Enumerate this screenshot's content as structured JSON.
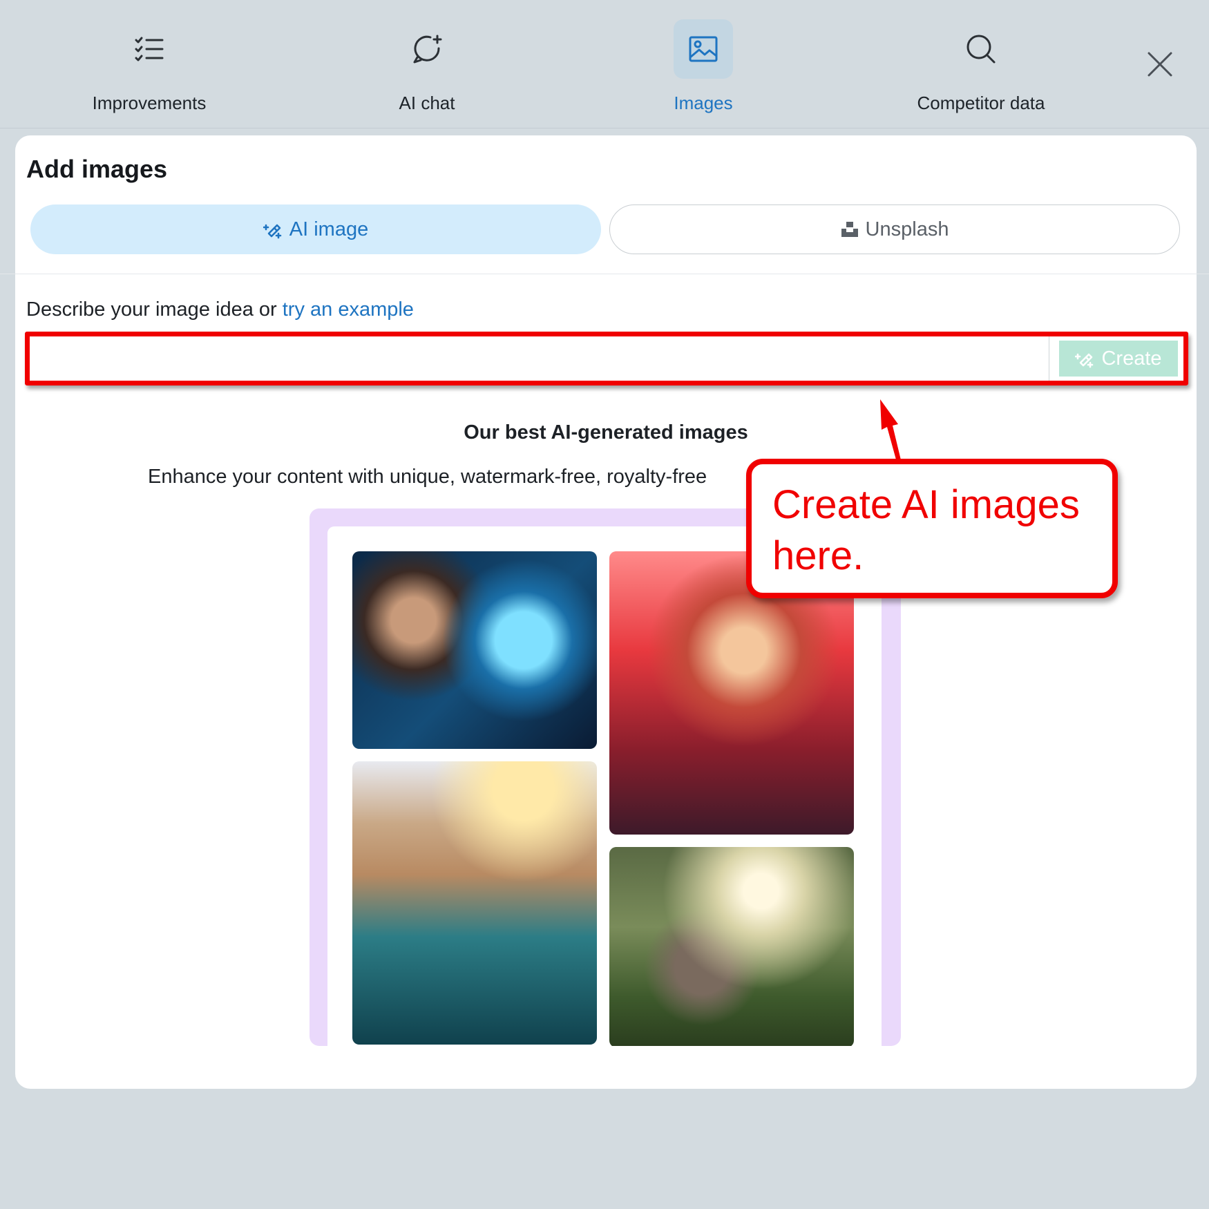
{
  "tabs": [
    {
      "label": "Improvements",
      "icon": "checklist-icon"
    },
    {
      "label": "AI chat",
      "icon": "chat-sparkle-icon"
    },
    {
      "label": "Images",
      "icon": "image-icon"
    },
    {
      "label": "Competitor data",
      "icon": "search-icon"
    }
  ],
  "active_tab": "Images",
  "panel": {
    "title": "Add images",
    "segments": {
      "ai_label": "AI image",
      "unsplash_label": "Unsplash"
    },
    "describe_prefix": "Describe your image idea or ",
    "describe_link": "try an example",
    "prompt_value": "",
    "create_label": "Create",
    "best_title": "Our best AI-generated images",
    "enhance_text": "Enhance your content with unique, watermark-free, royalty-free"
  },
  "callout": {
    "line1": "Create AI images",
    "line2": "here."
  },
  "colors": {
    "accent": "#1e74c1",
    "highlight_red": "#f00000",
    "create_bg": "#b8e6d6",
    "gallery_bg": "#ead9fb"
  }
}
